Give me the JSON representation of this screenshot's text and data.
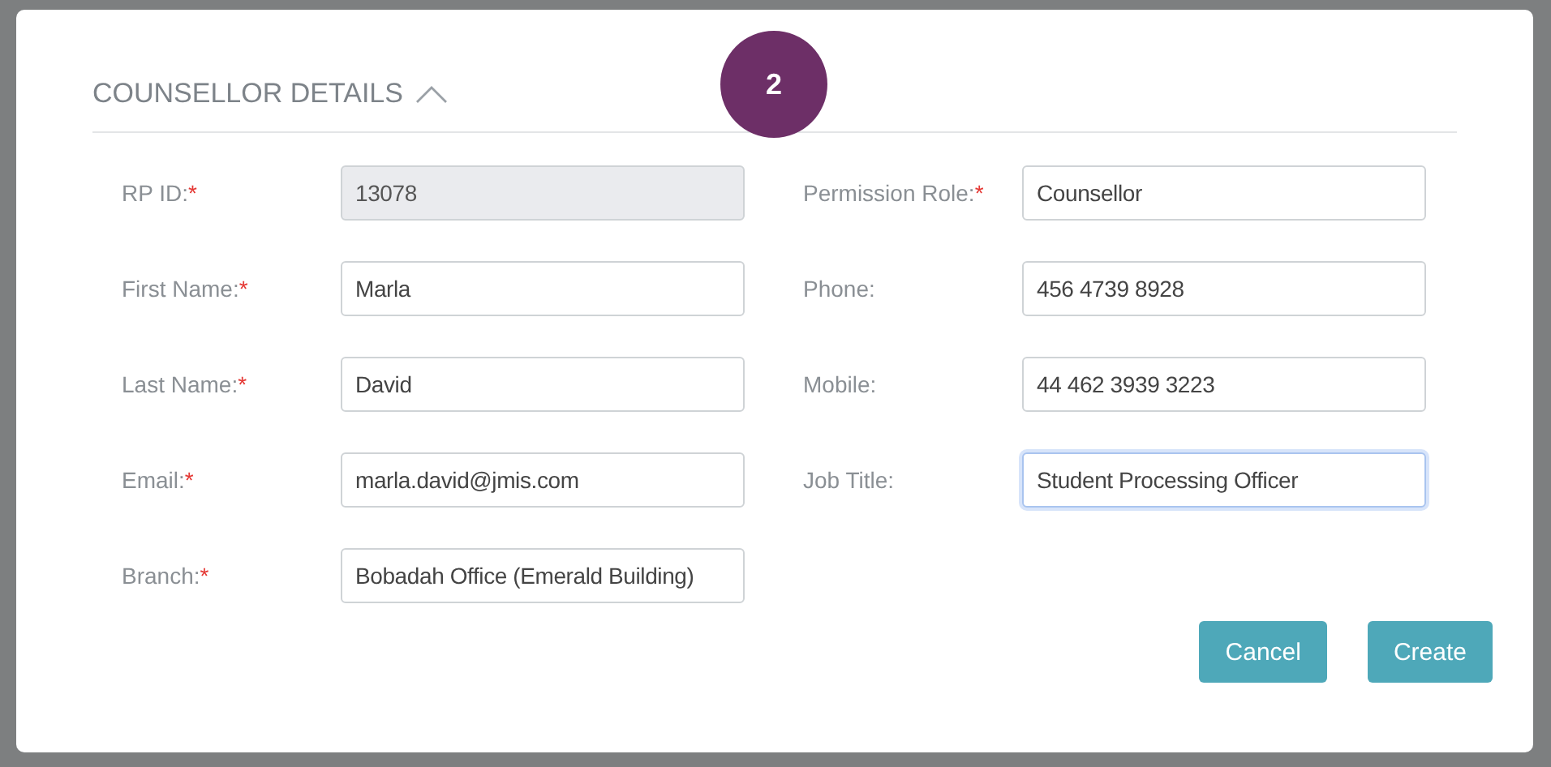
{
  "section": {
    "title": "COUNSELLOR DETAILS",
    "expanded": true
  },
  "step_badge": "2",
  "required_mark": "*",
  "left_fields": [
    {
      "label": "RP ID:",
      "required": true,
      "value": "13078",
      "disabled": true,
      "focused": false
    },
    {
      "label": "First Name:",
      "required": true,
      "value": "Marla",
      "disabled": false,
      "focused": false
    },
    {
      "label": "Last Name:",
      "required": true,
      "value": "David",
      "disabled": false,
      "focused": false
    },
    {
      "label": "Email:",
      "required": true,
      "value": "marla.david@jmis.com",
      "disabled": false,
      "focused": false
    },
    {
      "label": "Branch:",
      "required": true,
      "value": "Bobadah Office (Emerald Building)",
      "disabled": false,
      "focused": false
    }
  ],
  "right_fields": [
    {
      "label": "Permission Role:",
      "required": true,
      "value": "Counsellor",
      "disabled": false,
      "focused": false
    },
    {
      "label": "Phone:",
      "required": false,
      "value": "456 4739 8928",
      "disabled": false,
      "focused": false
    },
    {
      "label": "Mobile:",
      "required": false,
      "value": "44 462 3939 3223",
      "disabled": false,
      "focused": false
    },
    {
      "label": "Job Title:",
      "required": false,
      "value": "Student Processing Officer",
      "disabled": false,
      "focused": true
    }
  ],
  "buttons": [
    "Cancel",
    "Create"
  ]
}
